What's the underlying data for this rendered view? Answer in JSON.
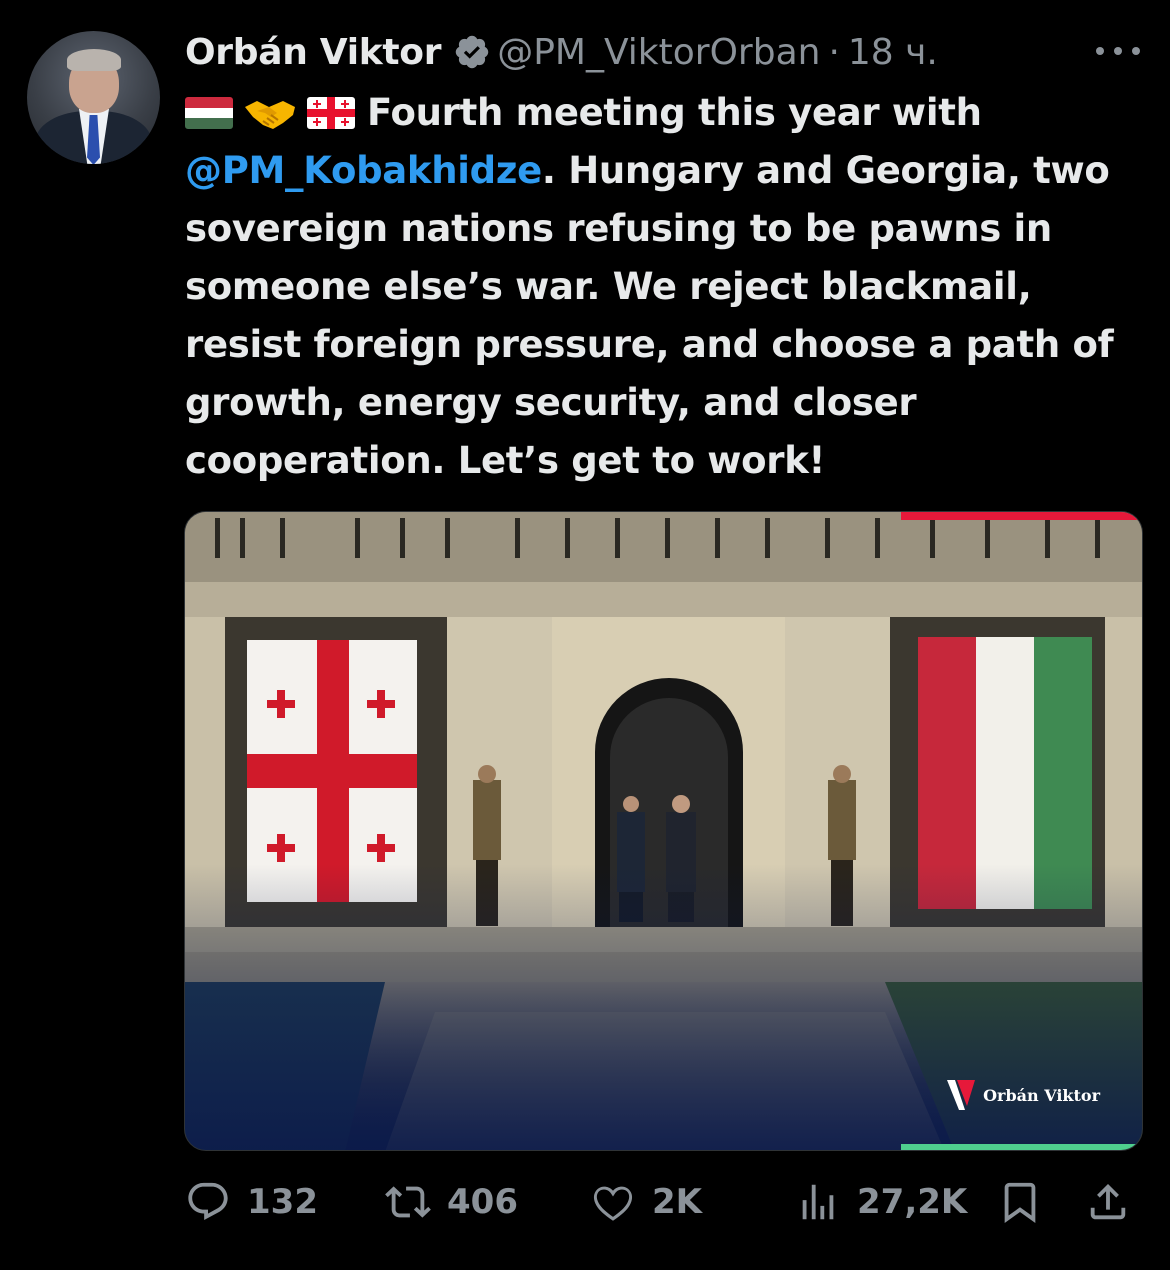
{
  "author": {
    "name": "Orbán Viktor",
    "handle": "@PM_ViktorOrban",
    "separator": "·",
    "time": "18 ч.",
    "verified": true,
    "avatar_icon": "profile-photo"
  },
  "tweet": {
    "emoji_prefix": [
      "flag-hungary",
      "handshake",
      "flag-georgia"
    ],
    "text_1": "Fourth meeting this year with",
    "mention": "@PM_Kobakhidze",
    "text_2": ". Hungary and Georgia, two sovereign nations refusing to be pawns in someone else’s war. We reject blackmail, resist foreign pressure, and choose a path of growth, energy security, and closer cooperation. Let’s get to work!"
  },
  "media": {
    "description_icon": "photo",
    "watermark": "Orbán Viktor"
  },
  "actions": {
    "replies": "132",
    "reposts": "406",
    "likes": "2K",
    "views": "27,2K"
  },
  "colors": {
    "background": "#000000",
    "text": "#e7e9ea",
    "muted": "#8b9299",
    "link": "#2f9bf0",
    "verified_badge": "#8b9299"
  }
}
